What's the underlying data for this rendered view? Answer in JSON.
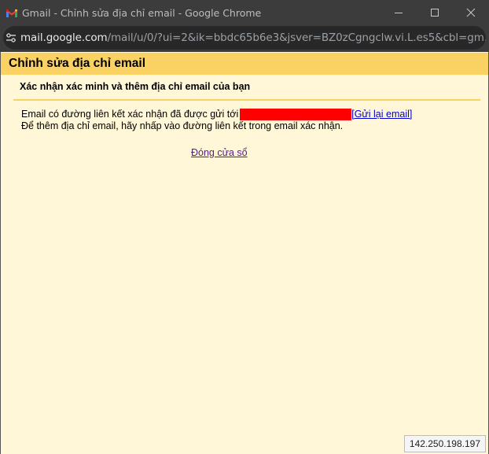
{
  "window": {
    "title": "Gmail - Chỉnh sửa địa chỉ email - Google Chrome",
    "icon": "gmail-icon",
    "controls": [
      "minimize-icon",
      "maximize-icon",
      "close-icon"
    ]
  },
  "address_bar": {
    "icon": "tune-icon",
    "host": "mail.google.com",
    "path": "/mail/u/0/?ui=2&ik=bbdc65b6e3&jsver=BZ0zCgngclw.vi.L.es5&cbl=gm..."
  },
  "dialog": {
    "title": "Chỉnh sửa địa chỉ email",
    "subtitle": "Xác nhận xác minh và thêm địa chỉ email của bạn",
    "message_line1": "Email có đường liên kết xác nhận đã được gửi tới",
    "resend_link": "[Gửi lại email]",
    "message_line2": "Để thêm địa chỉ email, hãy nhấp vào đường liên kết trong email xác nhận.",
    "close_link": "Đóng cửa sổ",
    "header_color": "#fad163",
    "background_color": "#fff7d7",
    "redaction_color": "#ff0000"
  },
  "status": {
    "ip": "142.250.198.197"
  }
}
